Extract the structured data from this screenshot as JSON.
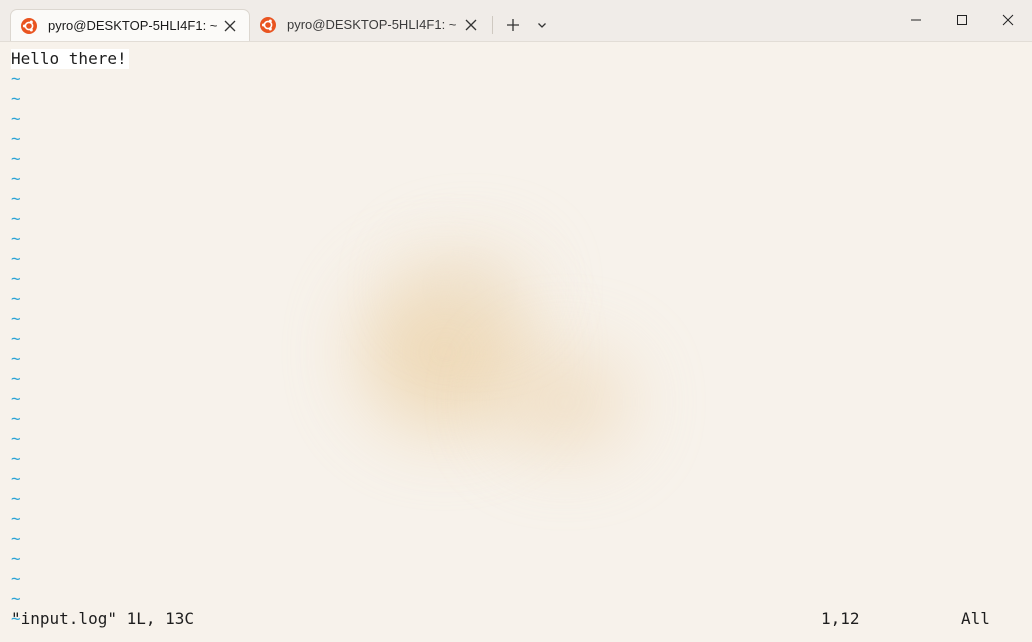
{
  "tabs": [
    {
      "title": "pyro@DESKTOP-5HLI4F1: ~",
      "active": true
    },
    {
      "title": "pyro@DESKTOP-5HLI4F1: ~",
      "active": false
    }
  ],
  "colors": {
    "ubuntu_orange": "#e95420",
    "tilde_blue": "#2aa3d6",
    "background": "#f7f2eb"
  },
  "buffer": {
    "lines": [
      "Hello there!"
    ],
    "empty_marker": "~",
    "empty_line_count": 28
  },
  "status": {
    "file_message": "\"input.log\" 1L, 13C",
    "cursor_position": "1,12",
    "scroll_position": "All"
  }
}
